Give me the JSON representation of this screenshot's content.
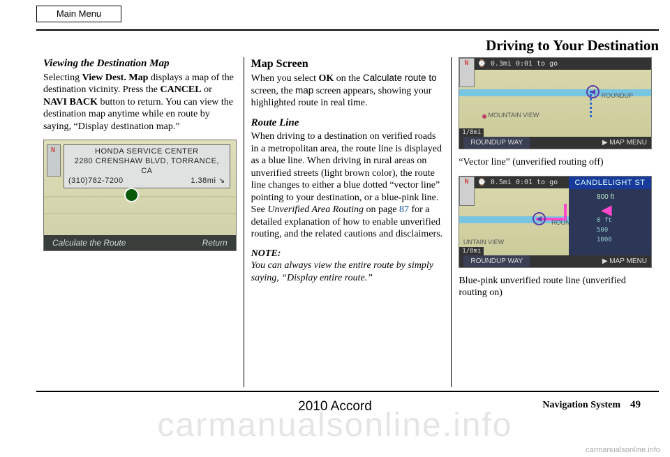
{
  "header": {
    "main_menu": "Main Menu",
    "section_title": "Driving to Your Destination"
  },
  "col1": {
    "heading": "Viewing the Destination Map",
    "p_pre": " Selecting ",
    "p_viewdest": "View Dest. Map",
    "p_mid1": " displays a map of the destination vicinity. Press the ",
    "p_cancel": "CANCEL",
    "p_or": " or ",
    "p_naviback": "NAVI BACK",
    "p_rest": " button to return. You can view the destination map anytime while en route by saying, “Display destination map.”",
    "shot": {
      "line1": "HONDA SERVICE CENTER",
      "line2": "2280 CRENSHAW BLVD, TORRANCE, CA",
      "line3_left": "(310)782-7200",
      "line3_right": "1.38mi ↘",
      "btn_calc": "Calculate the Route",
      "btn_return": "Return"
    }
  },
  "col2": {
    "heading": "Map Screen",
    "p1_pre": "When you select ",
    "p1_ok": "OK",
    "p1_mid": " on the ",
    "p1_calcroute": "Calculate route to",
    "p1_mid2": " screen, the ",
    "p1_map": "map",
    "p1_rest": " screen appears, showing your highlighted route in real time.",
    "subheading": "Route Line",
    "p2_pre": "When driving to a destination on verified roads in a metropolitan area, the route line is displayed as a blue line. When driving in rural areas on unverified streets (light brown color), the route line changes to either a blue dotted “vector line” pointing to your destination, or a blue-pink line. See ",
    "p2_link_i": "Unverified Area Routing",
    "p2_onpage": " on page ",
    "p2_pagenum": "87",
    "p2_rest": " for a detailed explanation of how to enable unverified routing, and the related cautions and disclaimers.",
    "note_label": "NOTE:",
    "note_text": "You can always view the entire route by simply saying, “Display entire route.”"
  },
  "col3": {
    "shot_a": {
      "top": "⌚ 0.3mi 0:01 to go",
      "scale": "1/8mi",
      "road": "ROUNDUP WAY",
      "road2": "MOUNTAIN VIEW",
      "menu": "▶ MAP MENU",
      "lbl_roundup": "ROUNDUP"
    },
    "caption_a": "“Vector line” (unverified routing off)",
    "shot_b": {
      "top": "⌚ 0.5mi 0:01 to go",
      "street": "CANDLELIGHT ST",
      "dist": "800 ft",
      "t0": "0 ft",
      "t1": "500",
      "t2": "1000",
      "scale": "1/8mi",
      "road": "ROUNDUP WAY",
      "road2": "UNTAIN VIEW",
      "menu": "▶ MAP MENU",
      "lbl_roundup": "ROUNDUP"
    },
    "caption_b": " Blue-pink unverified route line (unverified routing on)"
  },
  "footer": {
    "model": "2010 Accord",
    "navsys": "Navigation System",
    "page": "49"
  },
  "watermark": {
    "big": "carmanualsonline.info",
    "small": "carmanualsonline.info"
  }
}
